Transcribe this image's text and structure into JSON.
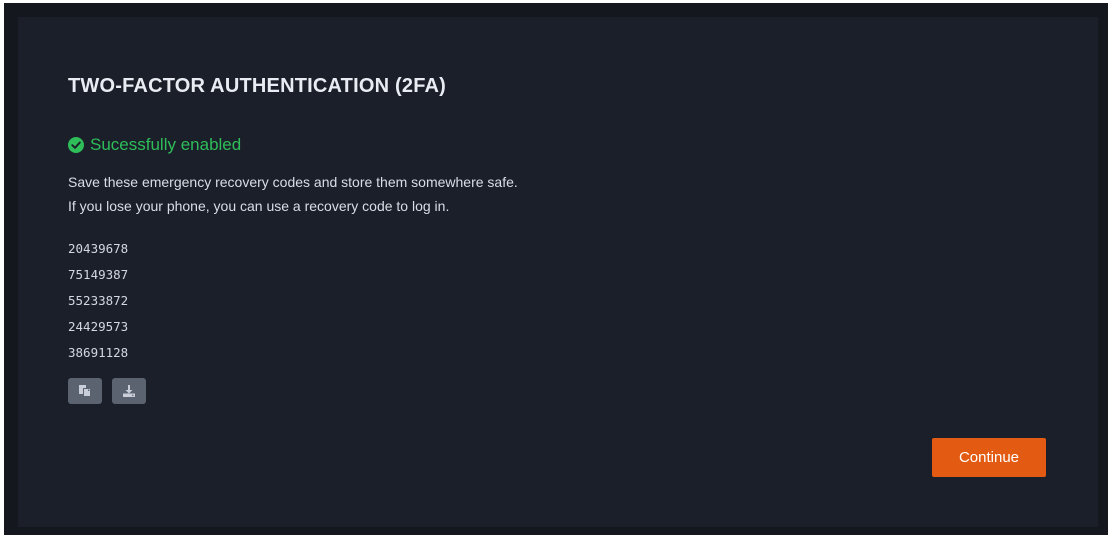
{
  "dialog": {
    "title": "TWO-FACTOR AUTHENTICATION (2FA)",
    "status": "Sucessfully enabled",
    "description_line1": "Save these emergency recovery codes and store them somewhere safe.",
    "description_line2": "If you lose your phone, you can use a recovery code to log in.",
    "recovery_codes": [
      "20439678",
      "75149387",
      "55233872",
      "24429573",
      "38691128"
    ],
    "actions": {
      "copy_icon": "copy-icon",
      "download_icon": "download-icon"
    },
    "continue_label": "Continue"
  },
  "colors": {
    "background": "#14171e",
    "card": "#1b1f29",
    "success": "#2ebd59",
    "accent": "#e35b12",
    "icon_button": "#5b6270"
  }
}
